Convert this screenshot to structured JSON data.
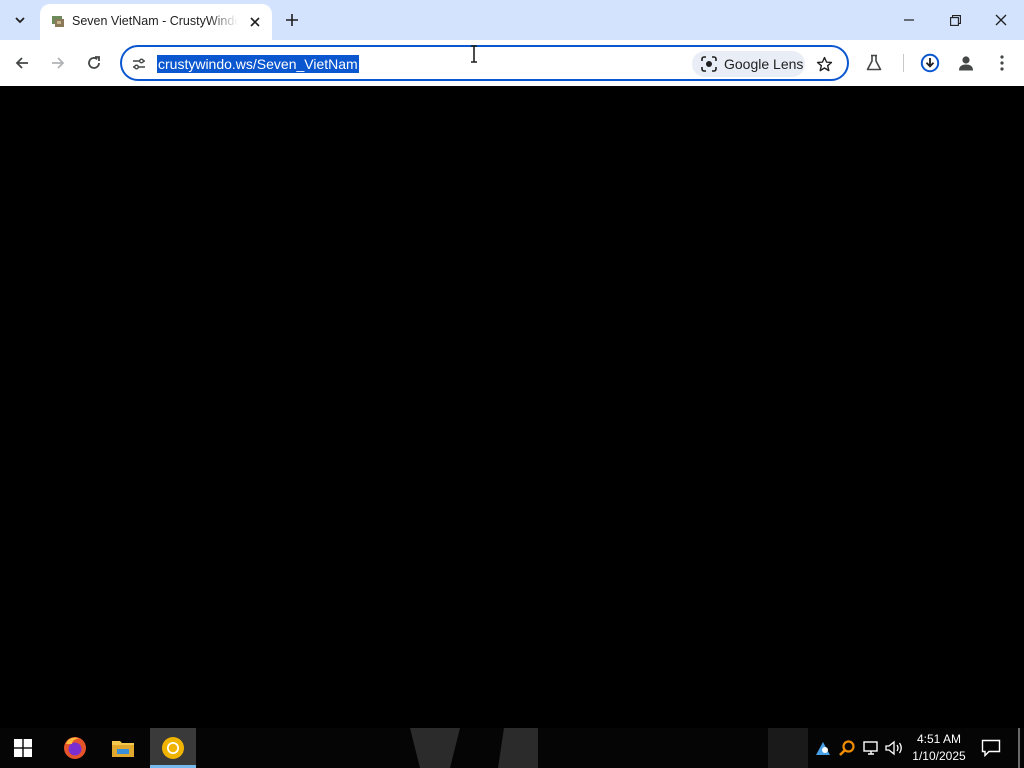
{
  "browser": {
    "tab": {
      "title": "Seven VietNam - CrustyWindows"
    },
    "omnibox": {
      "url": "crustywindo.ws/Seven_VietNam",
      "lens_label": "Google Lens"
    }
  },
  "taskbar": {
    "clock": {
      "time": "4:51 AM",
      "date": "1/10/2025"
    }
  },
  "colors": {
    "accent": "#0b57d0",
    "tabstrip": "#d3e3fd",
    "page_background": "#000000",
    "taskbar": "#050505"
  }
}
